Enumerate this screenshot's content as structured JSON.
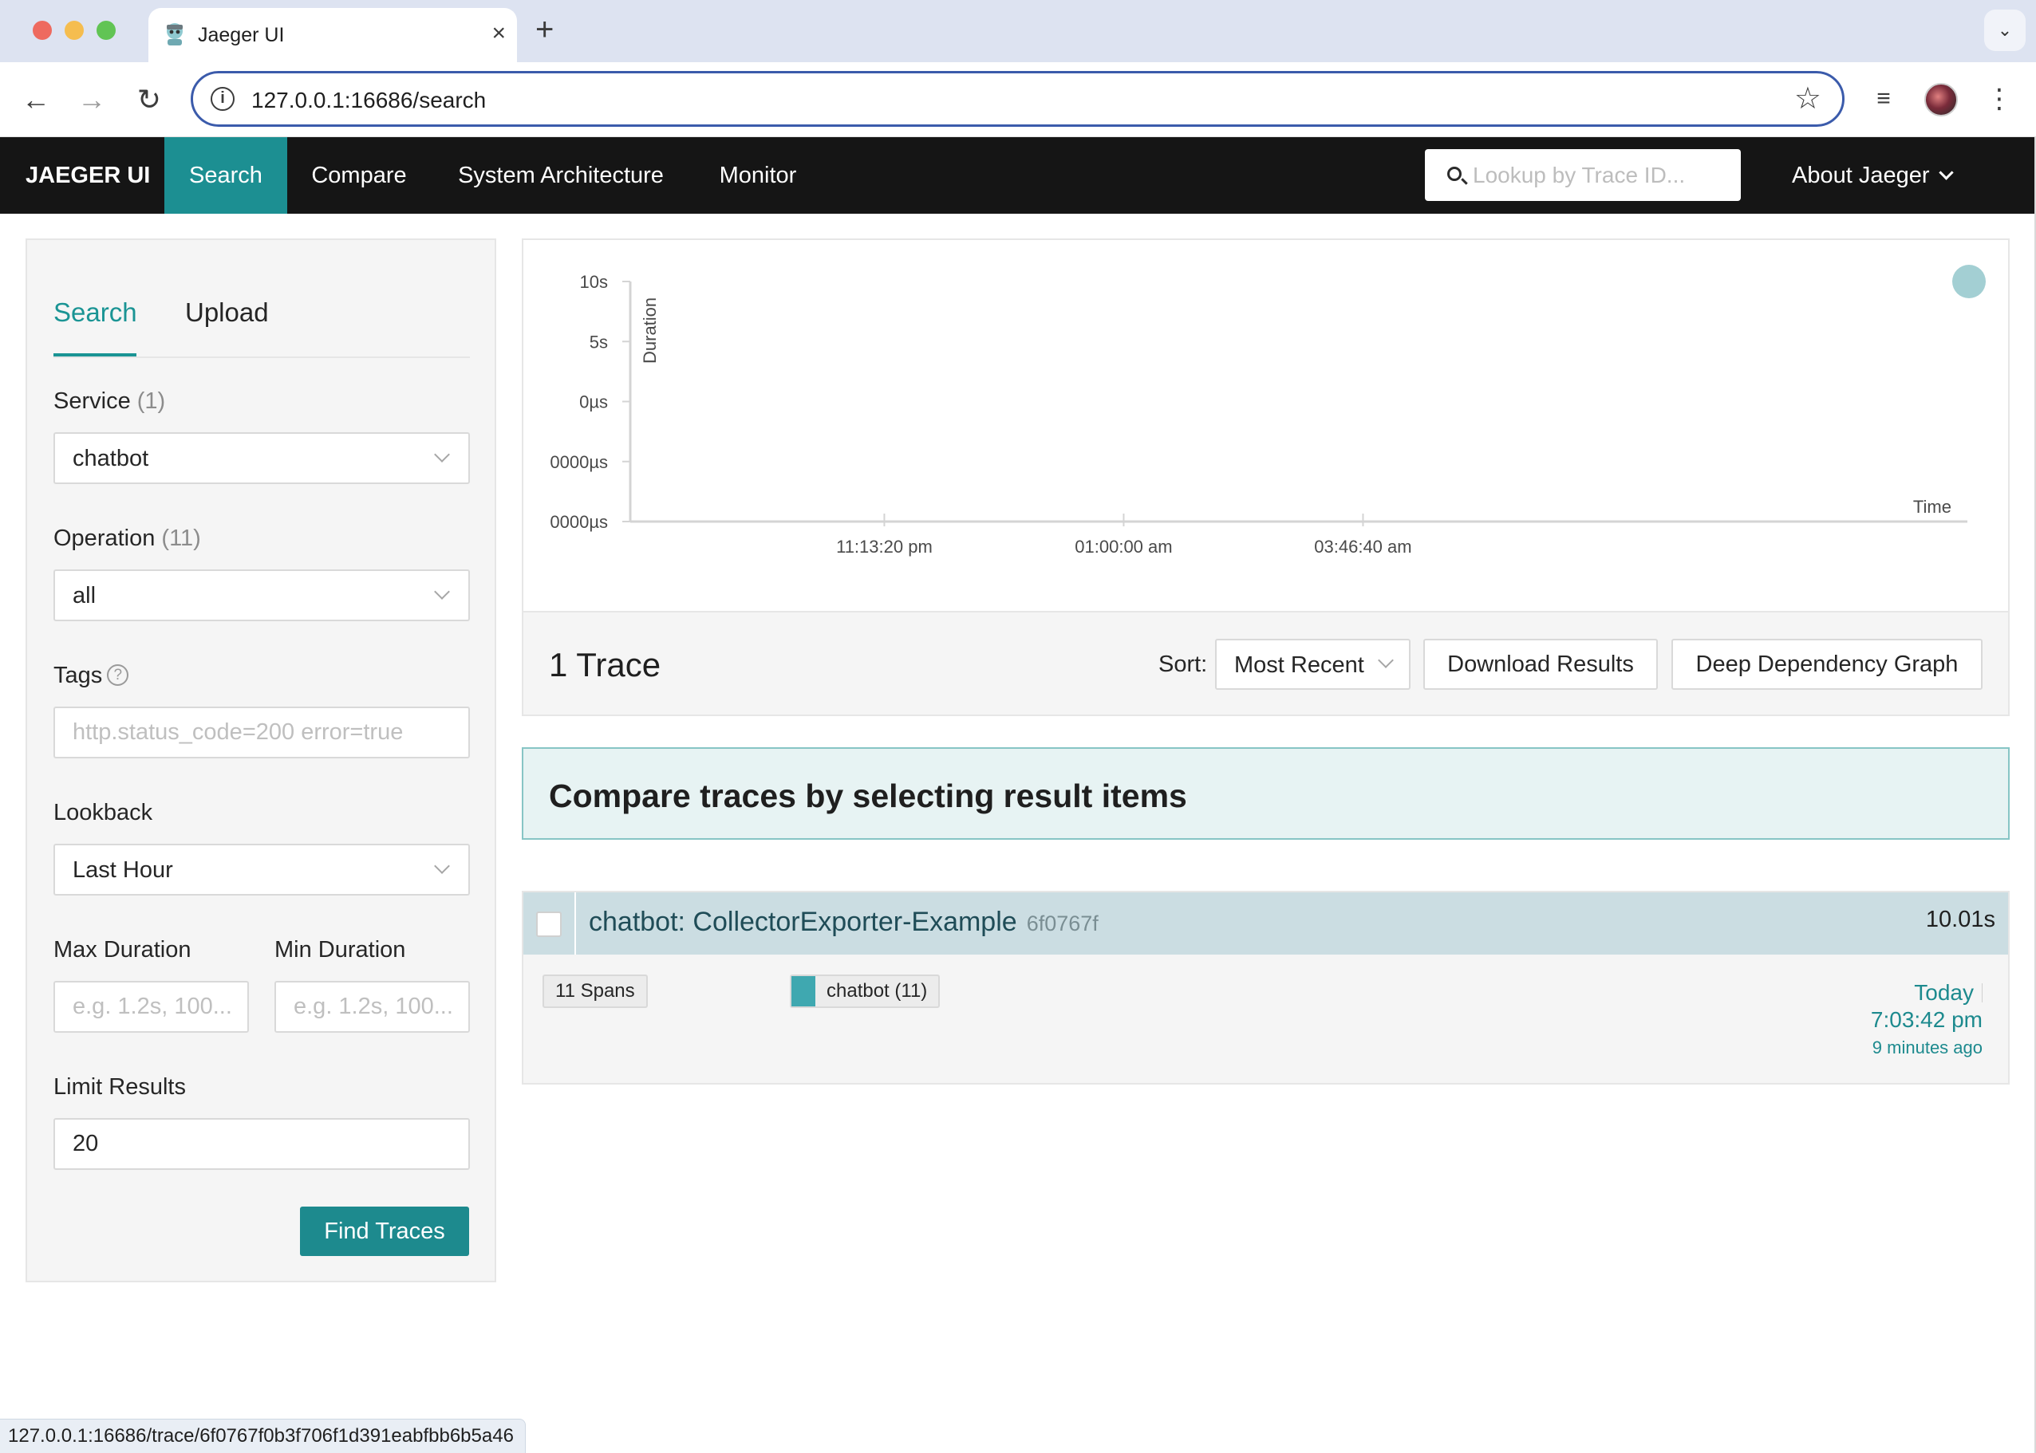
{
  "browser": {
    "tab_title": "Jaeger UI",
    "tab_close": "×",
    "new_tab": "+",
    "url": "127.0.0.1:16686/search",
    "status_url": "127.0.0.1:16686/trace/6f0767f0b3f706f1d391eabfbb6b5a46"
  },
  "nav": {
    "brand": "JAEGER UI",
    "items": [
      {
        "label": "Search",
        "active": true
      },
      {
        "label": "Compare"
      },
      {
        "label": "System Architecture"
      },
      {
        "label": "Monitor"
      }
    ],
    "trace_lookup_placeholder": "Lookup by Trace ID...",
    "about": "About Jaeger"
  },
  "search_panel": {
    "tabs": [
      "Search",
      "Upload"
    ],
    "service": {
      "label": "Service",
      "count": "(1)",
      "value": "chatbot"
    },
    "operation": {
      "label": "Operation",
      "count": "(11)",
      "value": "all"
    },
    "tags": {
      "label": "Tags",
      "help": "?",
      "placeholder": "http.status_code=200 error=true"
    },
    "lookback": {
      "label": "Lookback",
      "value": "Last Hour"
    },
    "max_duration": {
      "label": "Max Duration",
      "placeholder": "e.g. 1.2s, 100..."
    },
    "min_duration": {
      "label": "Min Duration",
      "placeholder": "e.g. 1.2s, 100..."
    },
    "limit": {
      "label": "Limit Results",
      "value": "20"
    },
    "find_button": "Find Traces"
  },
  "chart_data": {
    "type": "scatter",
    "xlabel": "Time",
    "ylabel": "Duration",
    "y_tick_labels": [
      "10s",
      "5s",
      "0µs",
      "0000µs",
      "0000µs"
    ],
    "x_tick_labels": [
      "11:13:20 pm",
      "01:00:00 am",
      "03:46:40 am"
    ],
    "points": [
      {
        "label": "chatbot: CollectorExporter-Example",
        "duration_s": 10.01
      }
    ],
    "point_color": "#a3cfd3",
    "grid": false
  },
  "results": {
    "count_label": "1 Trace",
    "sort_label": "Sort:",
    "sort_value": "Most Recent",
    "download_button": "Download Results",
    "ddg_button": "Deep Dependency Graph",
    "compare_banner": "Compare traces by selecting result items",
    "traces": [
      {
        "name": "chatbot: CollectorExporter-Example",
        "trace_id": "6f0767f",
        "duration": "10.01s",
        "spans": "11 Spans",
        "service_tag": "chatbot (11)",
        "service_color": "#3fa8b0",
        "day": "Today",
        "time": "7:03:42 pm",
        "ago": "9 minutes ago"
      }
    ]
  }
}
